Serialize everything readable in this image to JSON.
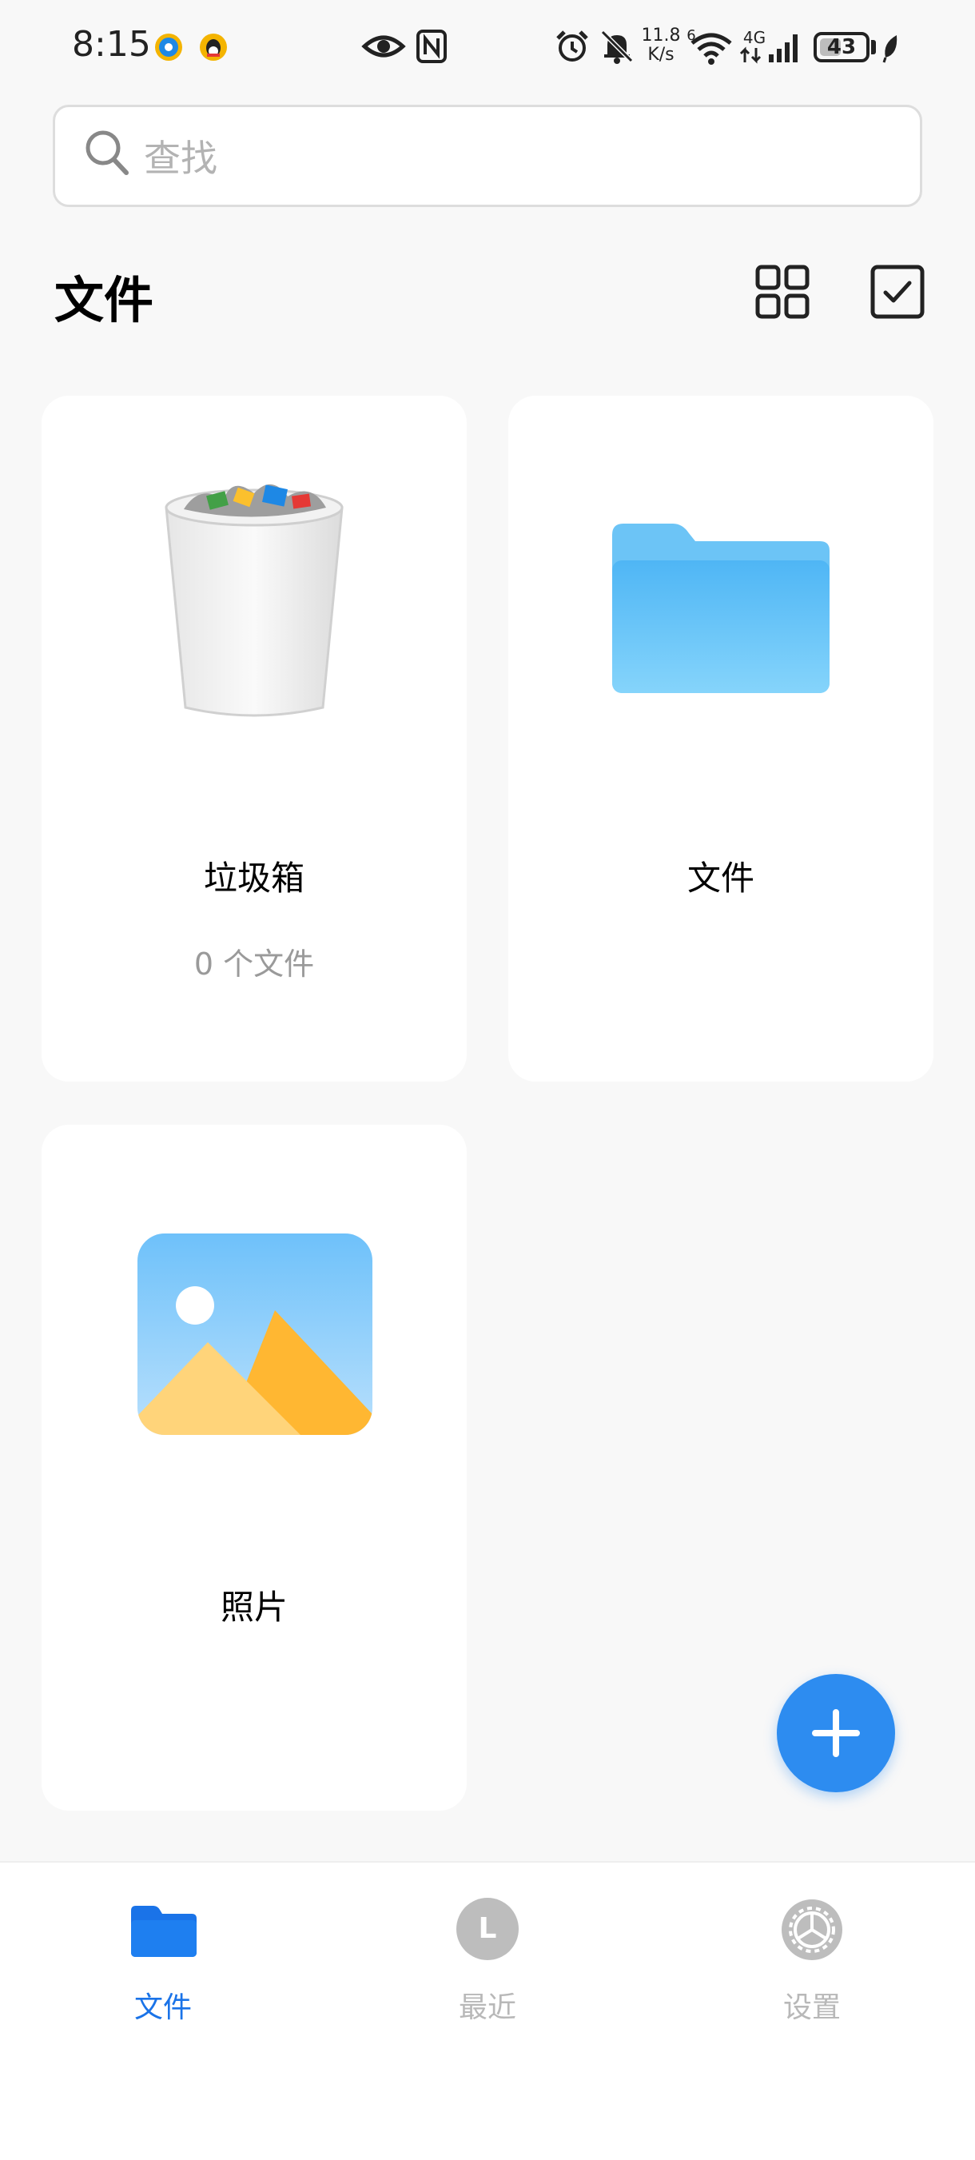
{
  "status_bar": {
    "time": "8:15",
    "net_speed_value": "11.8",
    "net_speed_unit": "K/s",
    "wifi_badge": "6",
    "cell_type": "4G",
    "battery": "43"
  },
  "search": {
    "placeholder": "查找"
  },
  "header": {
    "title": "文件"
  },
  "cards": [
    {
      "label": "垃圾箱",
      "subtitle": "0 个文件",
      "icon": "trash-can-icon"
    },
    {
      "label": "文件",
      "icon": "folder-icon"
    },
    {
      "label": "照片",
      "icon": "photo-icon"
    }
  ],
  "fab": {
    "icon": "plus-icon"
  },
  "bottom_nav": {
    "items": [
      {
        "label": "文件",
        "icon": "folder-icon",
        "active": true
      },
      {
        "label": "最近",
        "icon": "recent-icon",
        "badge": "L",
        "active": false
      },
      {
        "label": "设置",
        "icon": "gear-icon",
        "active": false
      }
    ]
  },
  "colors": {
    "accent": "#2d8cf0",
    "nav_active": "#1a73e8",
    "nav_inactive": "#b8b8b8",
    "background": "#f8f8f8"
  }
}
